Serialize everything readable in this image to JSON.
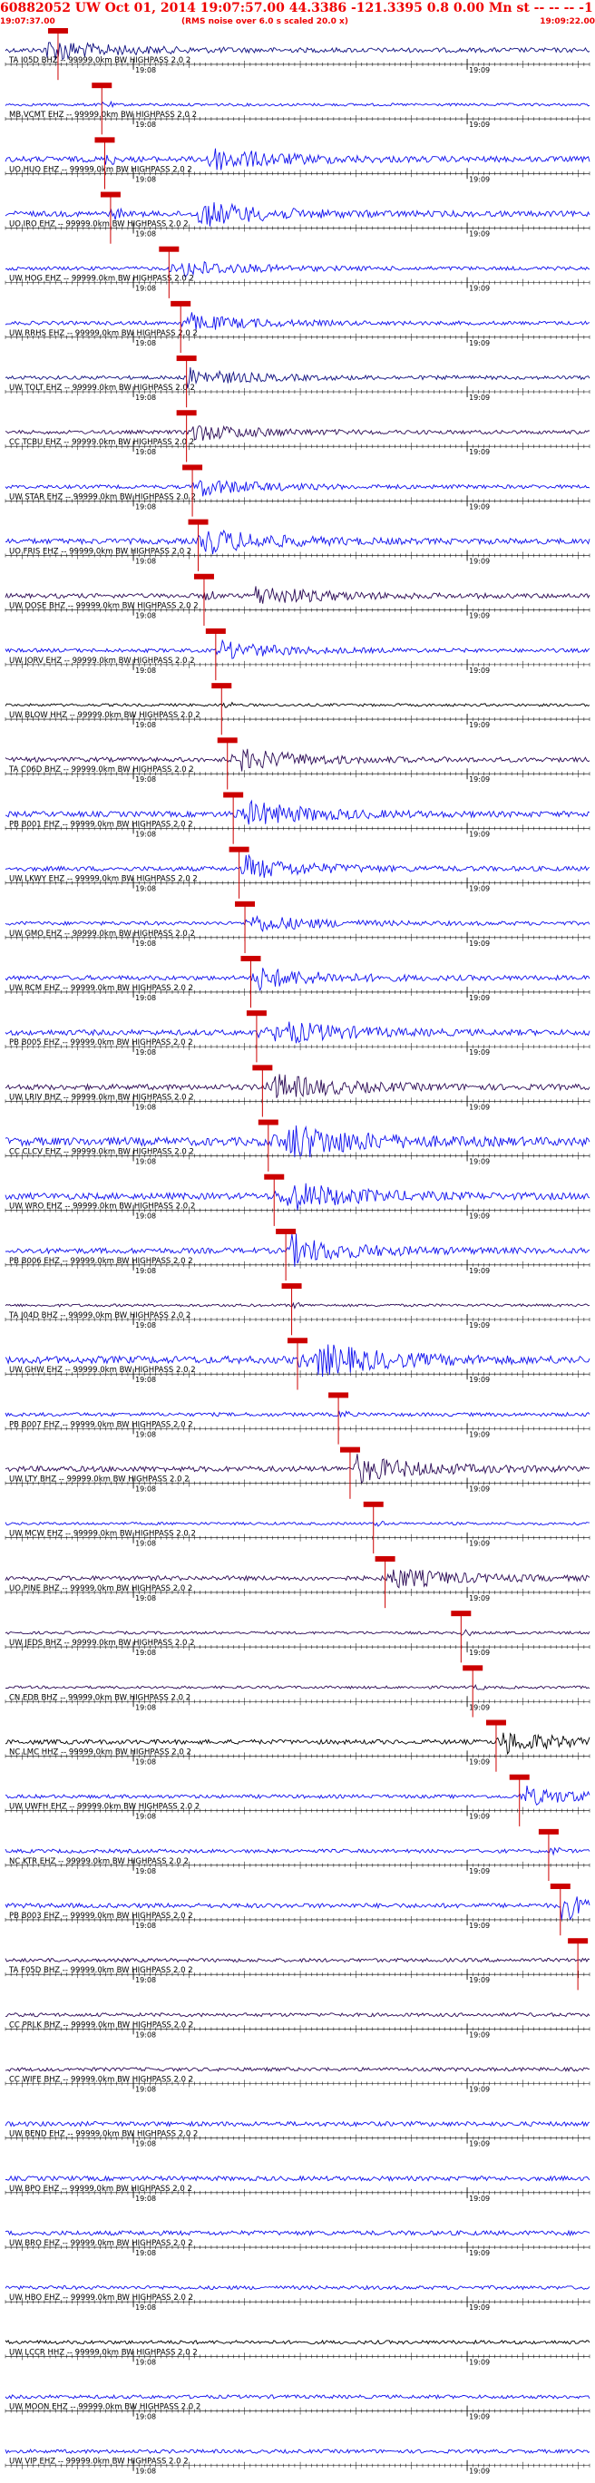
{
  "header": {
    "title": "60882052 UW Oct 01, 2014 19:07:57.00   44.3386 -121.3395  0.8 0.00 Mn st -- -- --  -1",
    "start_time": "19:07:37.00",
    "note": "(RMS noise over 6.0 s scaled 20.0 x)",
    "end_time": "19:09:22.00"
  },
  "colors": {
    "title": "#ee0000",
    "pick": "#cc0000",
    "trace_blue": "#1010ee",
    "trace_navy": "#101080",
    "trace_purple": "#2b0a55",
    "trace_black": "#000000",
    "axis": "#000000"
  },
  "chart_data": {
    "type": "line",
    "xlim": [
      "19:07:37.00",
      "19:09:22.00"
    ],
    "time_ticks": [
      "19:08",
      "19:09"
    ],
    "traces": [
      {
        "label": "TA I05D BHZ -- 99999.0km BW  HIGHPASS  2.0  2",
        "pick": 0.09,
        "color": "navy",
        "amp": 5,
        "burst": 0.065
      },
      {
        "label": "MB VCMT EHZ -- 99999.0km BW  HIGHPASS  2.0  2",
        "pick": 0.165,
        "color": "blue",
        "amp": 3,
        "burst": null
      },
      {
        "label": "UO HUO EHZ -- 99999.0km BW  HIGHPASS  2.0  2",
        "pick": 0.17,
        "color": "blue",
        "amp": 6,
        "burst": 0.34
      },
      {
        "label": "UO IRO EHZ -- 99999.0km BW  HIGHPASS  2.0  2",
        "pick": 0.18,
        "color": "blue",
        "amp": 6,
        "burst": 0.33
      },
      {
        "label": "UW HOG EHZ -- 99999.0km BW  HIGHPASS  2.0  2",
        "pick": 0.28,
        "color": "blue",
        "amp": 4,
        "burst": 0.3
      },
      {
        "label": "UW RRHS EHZ -- 99999.0km BW  HIGHPASS  2.0  2",
        "pick": 0.3,
        "color": "blue",
        "amp": 4,
        "burst": 0.31
      },
      {
        "label": "UW TOLT EHZ -- 99999.0km BW  HIGHPASS  2.0  2",
        "pick": 0.31,
        "color": "navy",
        "amp": 4,
        "burst": 0.31
      },
      {
        "label": "CC TCBU EHZ -- 99999.0km BW  HIGHPASS  2.0  2",
        "pick": 0.31,
        "color": "purple",
        "amp": 4,
        "burst": 0.32
      },
      {
        "label": "UW STAR EHZ -- 99999.0km BW  HIGHPASS  2.0  2",
        "pick": 0.32,
        "color": "blue",
        "amp": 4,
        "burst": 0.33
      },
      {
        "label": "UO FRIS EHZ -- 99999.0km BW  HIGHPASS  2.0  2",
        "pick": 0.33,
        "color": "blue",
        "amp": 6,
        "burst": 0.34
      },
      {
        "label": "UW DOSE BHZ -- 99999.0km BW  HIGHPASS  2.0  2",
        "pick": 0.34,
        "color": "purple",
        "amp": 5,
        "burst": 0.42
      },
      {
        "label": "UW JORV EHZ -- 99999.0km BW  HIGHPASS  2.0  2",
        "pick": 0.36,
        "color": "blue",
        "amp": 4,
        "burst": 0.37
      },
      {
        "label": "UW BLOW HHZ -- 99999.0km BW  HIGHPASS  2.0  2",
        "pick": 0.37,
        "color": "black",
        "amp": 3,
        "burst": null
      },
      {
        "label": "TA C06D BHZ -- 99999.0km BW  HIGHPASS  2.0  2",
        "pick": 0.38,
        "color": "purple",
        "amp": 5,
        "burst": 0.4
      },
      {
        "label": "PB B001 EHZ -- 99999.0km BW  HIGHPASS  2.0  2",
        "pick": 0.39,
        "color": "blue",
        "amp": 6,
        "burst": 0.41
      },
      {
        "label": "UW LKWY EHZ -- 99999.0km BW  HIGHPASS  2.0  2",
        "pick": 0.4,
        "color": "blue",
        "amp": 5,
        "burst": 0.41
      },
      {
        "label": "UW GMO EHZ -- 99999.0km BW  HIGHPASS  2.0  2",
        "pick": 0.41,
        "color": "blue",
        "amp": 4,
        "burst": 0.42
      },
      {
        "label": "UW RCM EHZ -- 99999.0km BW  HIGHPASS  2.0  2",
        "pick": 0.42,
        "color": "blue",
        "amp": 5,
        "burst": 0.43
      },
      {
        "label": "PB B005 EHZ -- 99999.0km BW  HIGHPASS  2.0  2",
        "pick": 0.43,
        "color": "blue",
        "amp": 6,
        "burst": 0.46
      },
      {
        "label": "UW LRIV BHZ -- 99999.0km BW  HIGHPASS  2.0  2",
        "pick": 0.44,
        "color": "purple",
        "amp": 6,
        "burst": 0.46
      },
      {
        "label": "CC CLCV EHZ -- 99999.0km BW  HIGHPASS  2.0  2",
        "pick": 0.45,
        "color": "blue",
        "amp": 9,
        "burst": 0.48
      },
      {
        "label": "UW WRO EHZ -- 99999.0km BW  HIGHPASS  2.0  2",
        "pick": 0.46,
        "color": "blue",
        "amp": 7,
        "burst": 0.48
      },
      {
        "label": "PB B006 EHZ -- 99999.0km BW  HIGHPASS  2.0  2",
        "pick": 0.48,
        "color": "blue",
        "amp": 6,
        "burst": 0.49
      },
      {
        "label": "TA J04D BHZ -- 99999.0km BW  HIGHPASS  2.0  2",
        "pick": 0.49,
        "color": "purple",
        "amp": 3,
        "burst": null
      },
      {
        "label": "UW GHW EHZ -- 99999.0km BW  HIGHPASS  2.0  2",
        "pick": 0.5,
        "color": "blue",
        "amp": 8,
        "burst": 0.53
      },
      {
        "label": "PB B007 EHZ -- 99999.0km BW  HIGHPASS  2.0  2",
        "pick": 0.57,
        "color": "blue",
        "amp": 4,
        "burst": null
      },
      {
        "label": "UW LTY BHZ -- 99999.0km BW  HIGHPASS  2.0  2",
        "pick": 0.59,
        "color": "purple",
        "amp": 6,
        "burst": 0.6
      },
      {
        "label": "UW MCW EHZ -- 99999.0km BW  HIGHPASS  2.0  2",
        "pick": 0.63,
        "color": "blue",
        "amp": 3,
        "burst": null
      },
      {
        "label": "UO PINE BHZ -- 99999.0km BW  HIGHPASS  2.0  2",
        "pick": 0.65,
        "color": "purple",
        "amp": 5,
        "burst": 0.66
      },
      {
        "label": "UW JEDS BHZ -- 99999.0km BW  HIGHPASS  2.0  2",
        "pick": 0.78,
        "color": "purple",
        "amp": 3,
        "burst": null
      },
      {
        "label": "CN EDB BHZ -- 99999.0km BW  HIGHPASS  2.0  2",
        "pick": 0.8,
        "color": "purple",
        "amp": 3,
        "burst": null
      },
      {
        "label": "NC LMC HHZ -- 99999.0km BW  HIGHPASS  2.0  2",
        "pick": 0.84,
        "color": "black",
        "amp": 5,
        "burst": 0.85
      },
      {
        "label": "UW UWFH EHZ -- 99999.0km BW  HIGHPASS  2.0  2",
        "pick": 0.88,
        "color": "blue",
        "amp": 4,
        "burst": 0.89
      },
      {
        "label": "NC KTR EHZ -- 99999.0km BW  HIGHPASS  2.0  2",
        "pick": 0.93,
        "color": "blue",
        "amp": 4,
        "burst": null
      },
      {
        "label": "PB B003 EHZ -- 99999.0km BW  HIGHPASS  2.0  2",
        "pick": 0.95,
        "color": "blue",
        "amp": 5,
        "burst": 0.95
      },
      {
        "label": "TA F05D BHZ -- 99999.0km BW  HIGHPASS  2.0  2",
        "pick": 0.98,
        "color": "purple",
        "amp": 4,
        "burst": null
      },
      {
        "label": "CC PRLK BHZ -- 99999.0km BW  HIGHPASS  2.0  2",
        "pick": null,
        "color": "purple",
        "amp": 4,
        "burst": null
      },
      {
        "label": "CC WIFE BHZ -- 99999.0km BW  HIGHPASS  2.0  2",
        "pick": null,
        "color": "purple",
        "amp": 4,
        "burst": null
      },
      {
        "label": "UW BEND EHZ -- 99999.0km BW  HIGHPASS  2.0  2",
        "pick": null,
        "color": "blue",
        "amp": 5,
        "burst": null
      },
      {
        "label": "UW BPO EHZ -- 99999.0km BW  HIGHPASS  2.0  2",
        "pick": null,
        "color": "blue",
        "amp": 5,
        "burst": null
      },
      {
        "label": "UW BRO EHZ -- 99999.0km BW  HIGHPASS  2.0  2",
        "pick": null,
        "color": "blue",
        "amp": 5,
        "burst": null
      },
      {
        "label": "UW HBO EHZ -- 99999.0km BW  HIGHPASS  2.0  2",
        "pick": null,
        "color": "blue",
        "amp": 4,
        "burst": null
      },
      {
        "label": "UW LCCR HHZ -- 99999.0km BW  HIGHPASS  2.0  2",
        "pick": null,
        "color": "black",
        "amp": 4,
        "burst": null
      },
      {
        "label": "UW MOON EHZ -- 99999.0km BW  HIGHPASS  2.0  2",
        "pick": null,
        "color": "blue",
        "amp": 4,
        "burst": null
      },
      {
        "label": "UW VIP EHZ -- 99999.0km BW  HIGHPASS  2.0  2",
        "pick": null,
        "color": "blue",
        "amp": 4,
        "burst": null
      }
    ]
  }
}
